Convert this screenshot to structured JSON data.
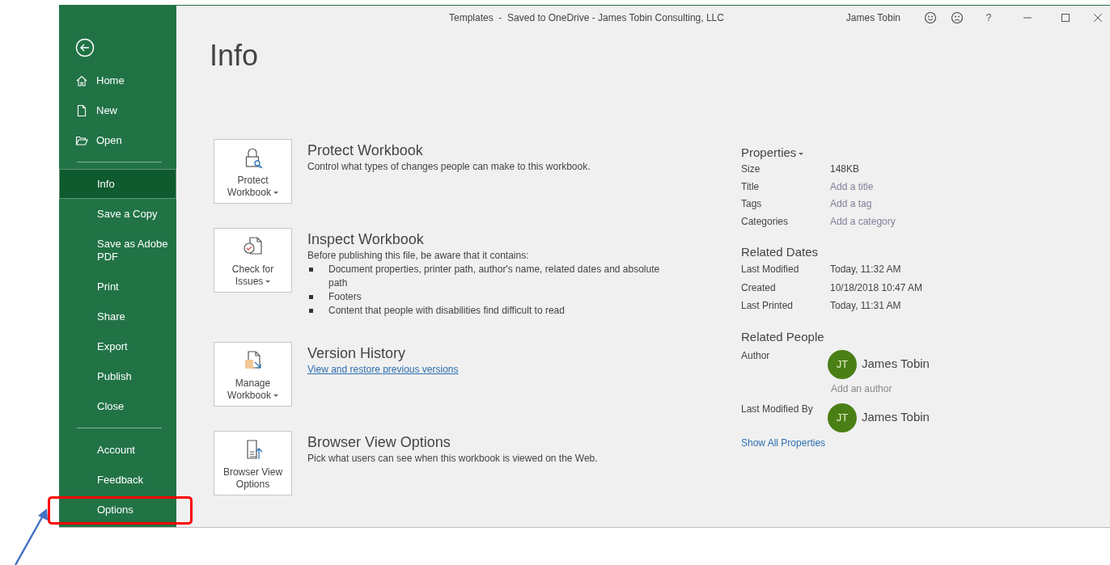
{
  "window": {
    "title": "Templates  -  Saved to OneDrive - James Tobin Consulting, LLC",
    "user": "James Tobin",
    "help": "?"
  },
  "sidebar": {
    "groups": [
      [
        {
          "label": "Home",
          "selected": false,
          "highlighted": false
        },
        {
          "label": "New",
          "selected": false,
          "highlighted": false
        },
        {
          "label": "Open",
          "selected": false,
          "highlighted": false
        }
      ],
      [
        {
          "label": "Info",
          "selected": true,
          "highlighted": false
        },
        {
          "label": "Save a Copy",
          "selected": false,
          "highlighted": false
        },
        {
          "label": "Save as Adobe PDF",
          "selected": false,
          "highlighted": false
        },
        {
          "label": "Print",
          "selected": false,
          "highlighted": false
        },
        {
          "label": "Share",
          "selected": false,
          "highlighted": false
        },
        {
          "label": "Export",
          "selected": false,
          "highlighted": false
        },
        {
          "label": "Publish",
          "selected": false,
          "highlighted": false
        },
        {
          "label": "Close",
          "selected": false,
          "highlighted": false
        }
      ],
      [
        {
          "label": "Account",
          "selected": false,
          "highlighted": false
        },
        {
          "label": "Feedback",
          "selected": false,
          "highlighted": false
        },
        {
          "label": "Options",
          "selected": false,
          "highlighted": true
        }
      ]
    ]
  },
  "page_title": "Info",
  "sections": [
    {
      "button": "Protect Workbook",
      "dropdown": true,
      "title": "Protect Workbook",
      "description": "Control what types of changes people can make to this workbook."
    },
    {
      "button": "Check for Issues",
      "dropdown": true,
      "title": "Inspect Workbook",
      "description": "Before publishing this file, be aware that it contains:",
      "bullets": [
        "Document properties, printer path, author's name, related dates and absolute path",
        "Footers",
        "Content that people with disabilities find difficult to read"
      ]
    },
    {
      "button": "Manage Workbook",
      "dropdown": true,
      "title": "Version History",
      "link": "View and restore previous versions"
    },
    {
      "button": "Browser View Options",
      "dropdown": false,
      "title": "Browser View Options",
      "description": "Pick what users can see when this workbook is viewed on the Web."
    }
  ],
  "properties": {
    "title": "Properties",
    "dropdown": true,
    "rows": [
      {
        "label": "Size",
        "value": "148KB"
      },
      {
        "label": "Title",
        "placeholder": "Add a title"
      },
      {
        "label": "Tags",
        "placeholder": "Add a tag"
      },
      {
        "label": "Categories",
        "placeholder": "Add a category"
      }
    ]
  },
  "related_dates": {
    "title": "Related Dates",
    "rows": [
      {
        "label": "Last Modified",
        "value": "Today, 11:32 AM"
      },
      {
        "label": "Created",
        "value": "10/18/2018 10:47 AM"
      },
      {
        "label": "Last Printed",
        "value": "Today, 11:31 AM"
      }
    ]
  },
  "related_people": {
    "title": "Related People",
    "groups": [
      {
        "label": "Author",
        "people": [
          {
            "initials": "JT",
            "name": "James Tobin"
          }
        ],
        "add_field": {
          "placeholder": "Add an author"
        }
      },
      {
        "label": "Last Modified By",
        "people": [
          {
            "initials": "JT",
            "name": "James Tobin"
          }
        ]
      }
    ]
  },
  "show_all_link": "Show All Properties"
}
